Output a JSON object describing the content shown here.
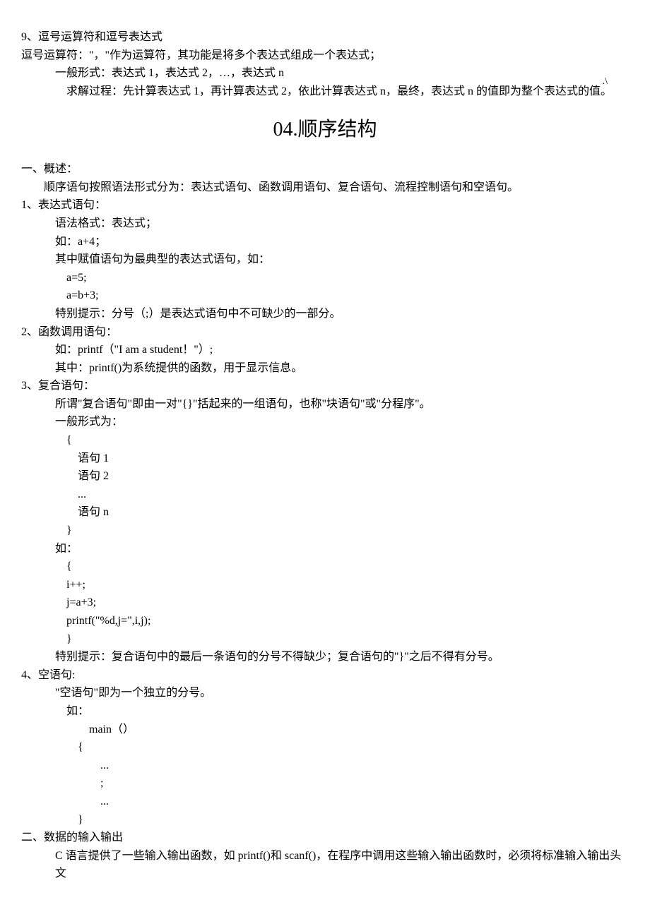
{
  "pageMarker": ".\\",
  "section9": {
    "heading": "9、逗号运算符和逗号表达式",
    "line1": "逗号运算符：\"，\"作为运算符，其功能是将多个表达式组成一个表达式；",
    "line2": "一般形式：表达式 1，表达式 2，…，表达式 n",
    "line3": "求解过程：先计算表达式 1，再计算表达式 2，依此计算表达式 n，最终，表达式 n 的值即为整个表达式的值。"
  },
  "title": "04.顺序结构",
  "overview": {
    "heading": "一、概述：",
    "text": "顺序语句按照语法形式分为：表达式语句、函数调用语句、复合语句、流程控制语句和空语句。"
  },
  "item1": {
    "heading": "1、表达式语句：",
    "l1": "语法格式：表达式；",
    "l2": "如：a+4；",
    "l3": "其中赋值语句为最典型的表达式语句，如：",
    "l4": "a=5;",
    "l5": "a=b+3;",
    "l6": "特别提示：分号（;）是表达式语句中不可缺少的一部分。"
  },
  "item2": {
    "heading": "2、函数调用语句：",
    "l1": "如：printf（\"I am a student！\"）;",
    "l2": "其中：printf()为系统提供的函数，用于显示信息。"
  },
  "item3": {
    "heading": "3、复合语句：",
    "l1": "所谓\"复合语句\"即由一对\"{}\"括起来的一组语句，也称\"块语句\"或\"分程序\"。",
    "l2": "一般形式为：",
    "l3": "{",
    "l4": "语句 1",
    "l5": "语句 2",
    "l6": "...",
    "l7": "语句 n",
    "l8": "}",
    "l9": "如：",
    "l10": "{",
    "l11": "i++;",
    "l12": "j=a+3;",
    "l13": "printf(\"%d,j=\",i,j);",
    "l14": "}",
    "l15": "特别提示：复合语句中的最后一条语句的分号不得缺少；复合语句的\"}\"之后不得有分号。"
  },
  "item4": {
    "heading": "4、空语句:",
    "l1": "\"空语句\"即为一个独立的分号。",
    "l2": "如：",
    "l3": "main（）",
    "l4": "{",
    "l5": "...",
    "l6": ";",
    "l7": "...",
    "l8": "}"
  },
  "sectionIO": {
    "heading": "二、数据的输入输出",
    "text": "C 语言提供了一些输入输出函数，如 printf()和 scanf()，在程序中调用这些输入输出函数时，必须将标准输入输出头文"
  }
}
